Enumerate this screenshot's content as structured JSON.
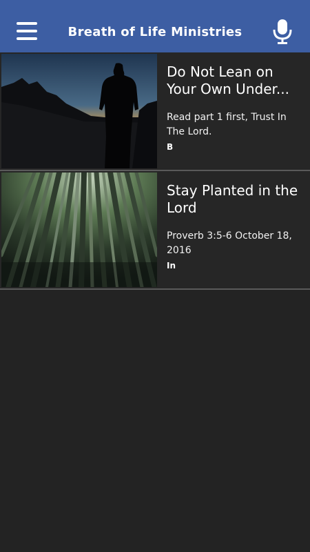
{
  "header": {
    "title": "Breath of Life Ministries",
    "menu_icon": "hamburger-menu-icon",
    "mic_icon": "microphone-icon",
    "bar_color": "#3d5ea3"
  },
  "items": [
    {
      "title": "Do Not Lean on Your Own Under...",
      "description": "Read part 1 first, Trust In The Lord.",
      "meta": "B",
      "image": "silhouette-mountain-sunset-image"
    },
    {
      "title": "Stay Planted in the Lord",
      "description": "Proverb 3:5-6 October 18, 2016",
      "meta": "In",
      "image": "bamboo-forest-image"
    }
  ]
}
